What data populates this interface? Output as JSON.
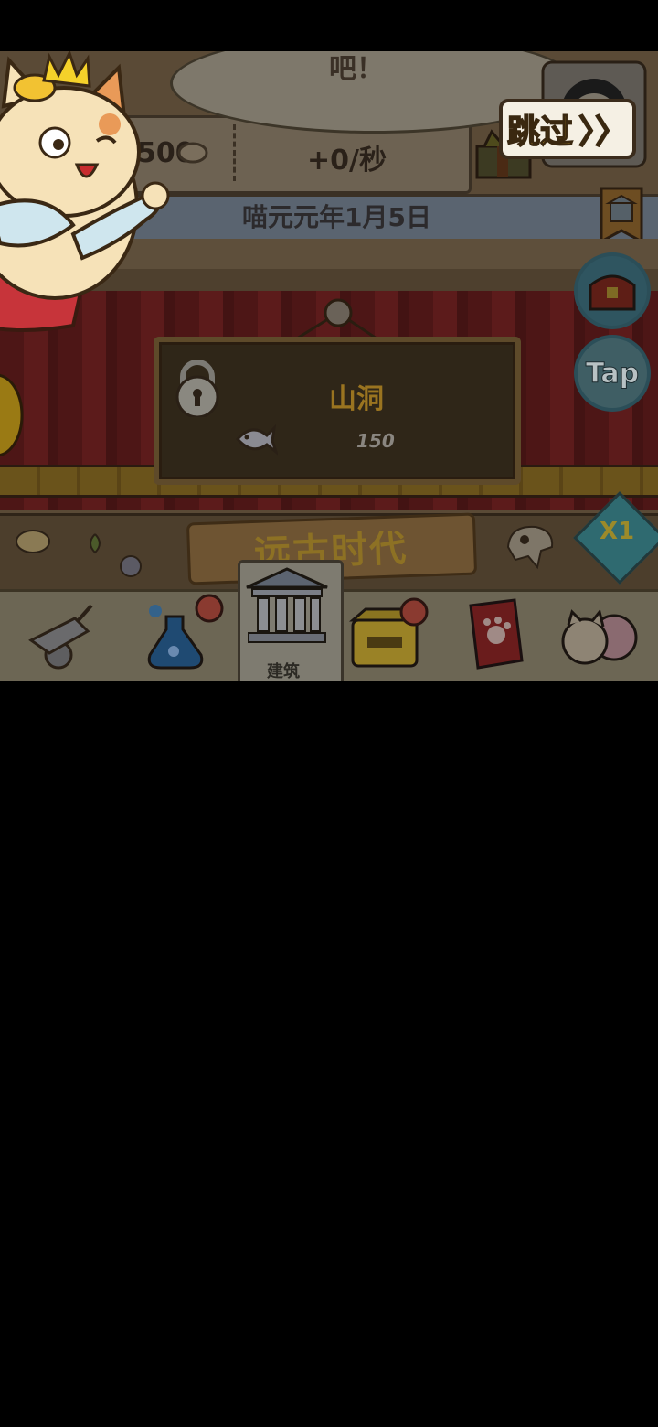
{
  "bubble": {
    "text": "吧！"
  },
  "skip_button": {
    "label": "跳过",
    "arrows": "〉〉"
  },
  "stats": {
    "currency_partial": "500",
    "rate": "+0/秒"
  },
  "date": {
    "text": "喵元元年1月5日"
  },
  "sign": {
    "title": "山洞",
    "price": "150",
    "locked": true
  },
  "era_banner": {
    "text": "远古时代"
  },
  "right_buttons": {
    "tap_label": "Tap",
    "speed_label": "X1"
  },
  "nav": {
    "items": [
      {
        "icon": "cart-icon"
      },
      {
        "icon": "potion-icon",
        "badge": true
      },
      {
        "icon": "building-icon",
        "label": "建筑",
        "selected": true
      },
      {
        "icon": "treasure-box-icon",
        "badge": true
      },
      {
        "icon": "paw-book-icon"
      },
      {
        "icon": "cat-faces-icon"
      }
    ]
  },
  "colors": {
    "accent_gold": "#f0c02a",
    "curtain_red": "#5c1b1b",
    "dim_overlay": "#000000"
  }
}
